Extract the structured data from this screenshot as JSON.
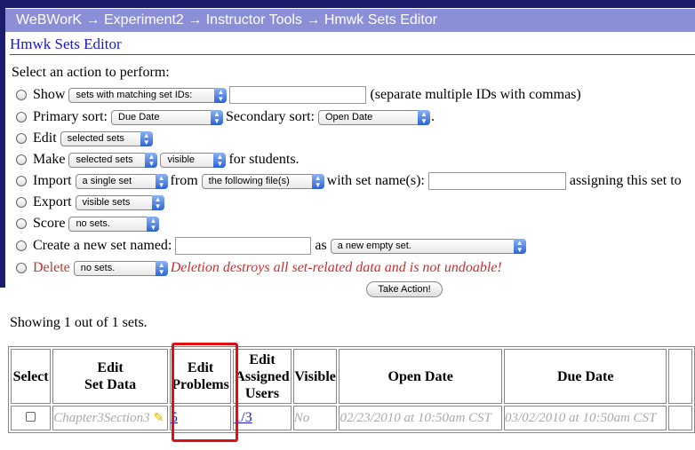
{
  "breadcrumb": {
    "items": [
      "WeBWorK",
      "Experiment2",
      "Instructor Tools",
      "Hmwk Sets Editor"
    ],
    "separator": "→"
  },
  "page_title": "Hmwk Sets Editor",
  "prompt": "Select an action to perform:",
  "actions": {
    "show": {
      "label": "Show",
      "select": "sets with matching set IDs:",
      "hint": "(separate multiple IDs with commas)",
      "input_value": ""
    },
    "sort": {
      "label": "Primary sort:",
      "primary": "Due Date",
      "secondary_label": "Secondary sort:",
      "secondary": "Open Date",
      "end": "."
    },
    "edit": {
      "label": "Edit",
      "select": "selected sets"
    },
    "make": {
      "label": "Make",
      "select1": "selected sets",
      "select2": "visible",
      "suffix": "for students."
    },
    "import": {
      "label": "Import",
      "select1": "a single set",
      "from_label": "from",
      "select2": "the following file(s)",
      "name_label": "with set name(s):",
      "input_value": "",
      "assign_label": "assigning this set to"
    },
    "export": {
      "label": "Export",
      "select": "visible sets"
    },
    "score": {
      "label": "Score",
      "select": "no sets."
    },
    "create": {
      "label": "Create a new set named:",
      "input_value": "",
      "as_label": "as",
      "select": "a new empty set."
    },
    "delete": {
      "label": "Delete",
      "select": "no sets.",
      "warning": "Deletion destroys all set-related data and is not undoable!"
    }
  },
  "take_action_label": "Take Action!",
  "showing_text": "Showing 1 out of 1 sets.",
  "table": {
    "headers": {
      "select": "Select",
      "edit_set_data_1": "Edit",
      "edit_set_data_2": "Set Data",
      "edit_problems_1": "Edit",
      "edit_problems_2": "Problems",
      "assigned_1": "Edit",
      "assigned_2": "Assigned",
      "assigned_3": "Users",
      "visible": "Visible",
      "open_date": "Open Date",
      "due_date": "Due Date"
    },
    "row": {
      "set_name": "Chapter3Section3",
      "problems": "5",
      "assigned": "1/3",
      "visible": "No",
      "open_date": "02/23/2010 at 10:50am CST",
      "due_date": "03/02/2010 at 10:50am CST"
    }
  },
  "colors": {
    "nav": "#1c1c6e",
    "breadcrumb_bg": "#8b8fd8",
    "title": "#1a1acc",
    "warning": "#c83030",
    "highlight": "#e01010"
  }
}
